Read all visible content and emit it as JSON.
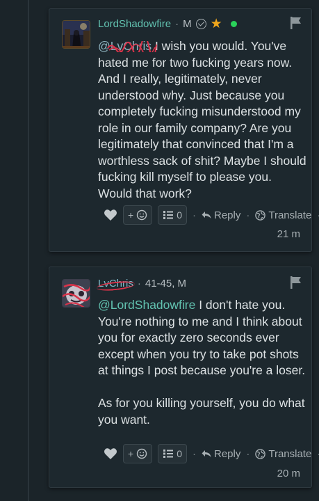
{
  "comments": [
    {
      "username": "LordShadowfire",
      "meta": "M",
      "mention": "@LvChris",
      "body": [
        " I wish you would. You've hated me for two fucking years now. And I really, legitimately, never understood why. Just because you completely fucking misunderstood my role in our family company? Are you legitimately that convinced that I'm a worthless sack of shit? Maybe I should fucking kill myself to please you. Would that work?"
      ],
      "reaction_label": "+",
      "list_count": "0",
      "reply_label": "Reply",
      "translate_label": "Translate",
      "time": "21 m"
    },
    {
      "username": "LvChris",
      "meta": "41-45, M",
      "mention": "@LordShadowfire",
      "body": [
        " I don't hate you. You're nothing to me and I think about you for exactly zero seconds ever except when you try to take pot shots at things I post because you're a loser.",
        "As for you killing yourself, you do what you want."
      ],
      "reaction_label": "+",
      "list_count": "0",
      "reply_label": "Reply",
      "translate_label": "Translate",
      "time": "20 m"
    }
  ],
  "colors": {
    "username": "#62c2b0",
    "star": "#f0a71c",
    "online": "#2ad25a",
    "scribble": "#d9334a"
  },
  "icons": [
    "verified-check-icon",
    "star-icon",
    "online-dot-icon",
    "flag-icon",
    "heart-icon",
    "smiley-icon",
    "list-icon",
    "reply-arrow-icon",
    "globe-icon"
  ]
}
